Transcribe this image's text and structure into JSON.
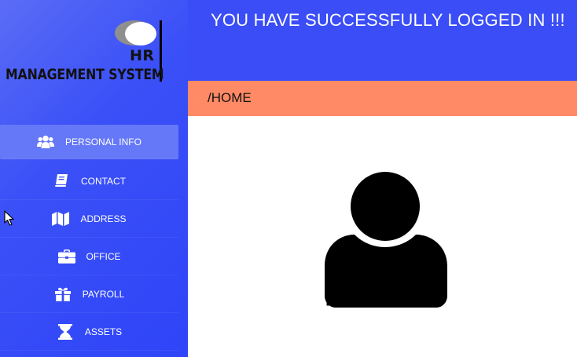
{
  "app": {
    "logo_top_text": "HR",
    "logo_bottom_text": "MANAGEMENT SYSTEM"
  },
  "header": {
    "title": "YOU HAVE SUCCESSFULLY LOGGED IN !!!"
  },
  "breadcrumb": {
    "path": "/HOME"
  },
  "sidebar": {
    "items": [
      {
        "label": "PERSONAL INFO",
        "icon": "users-icon",
        "active": true
      },
      {
        "label": "CONTACT",
        "icon": "book-icon",
        "active": false
      },
      {
        "label": "ADDRESS",
        "icon": "map-icon",
        "active": false
      },
      {
        "label": "OFFICE",
        "icon": "briefcase-icon",
        "active": false
      },
      {
        "label": "PAYROLL",
        "icon": "gift-icon",
        "active": false
      },
      {
        "label": "ASSETS",
        "icon": "hourglass-icon",
        "active": false
      }
    ]
  },
  "main": {
    "avatar_icon": "user-avatar-icon"
  },
  "colors": {
    "sidebar": "#3b50f7",
    "header": "#3a4df7",
    "breadcrumb_bar": "#ff8a65",
    "active_item": "#6578f8"
  }
}
